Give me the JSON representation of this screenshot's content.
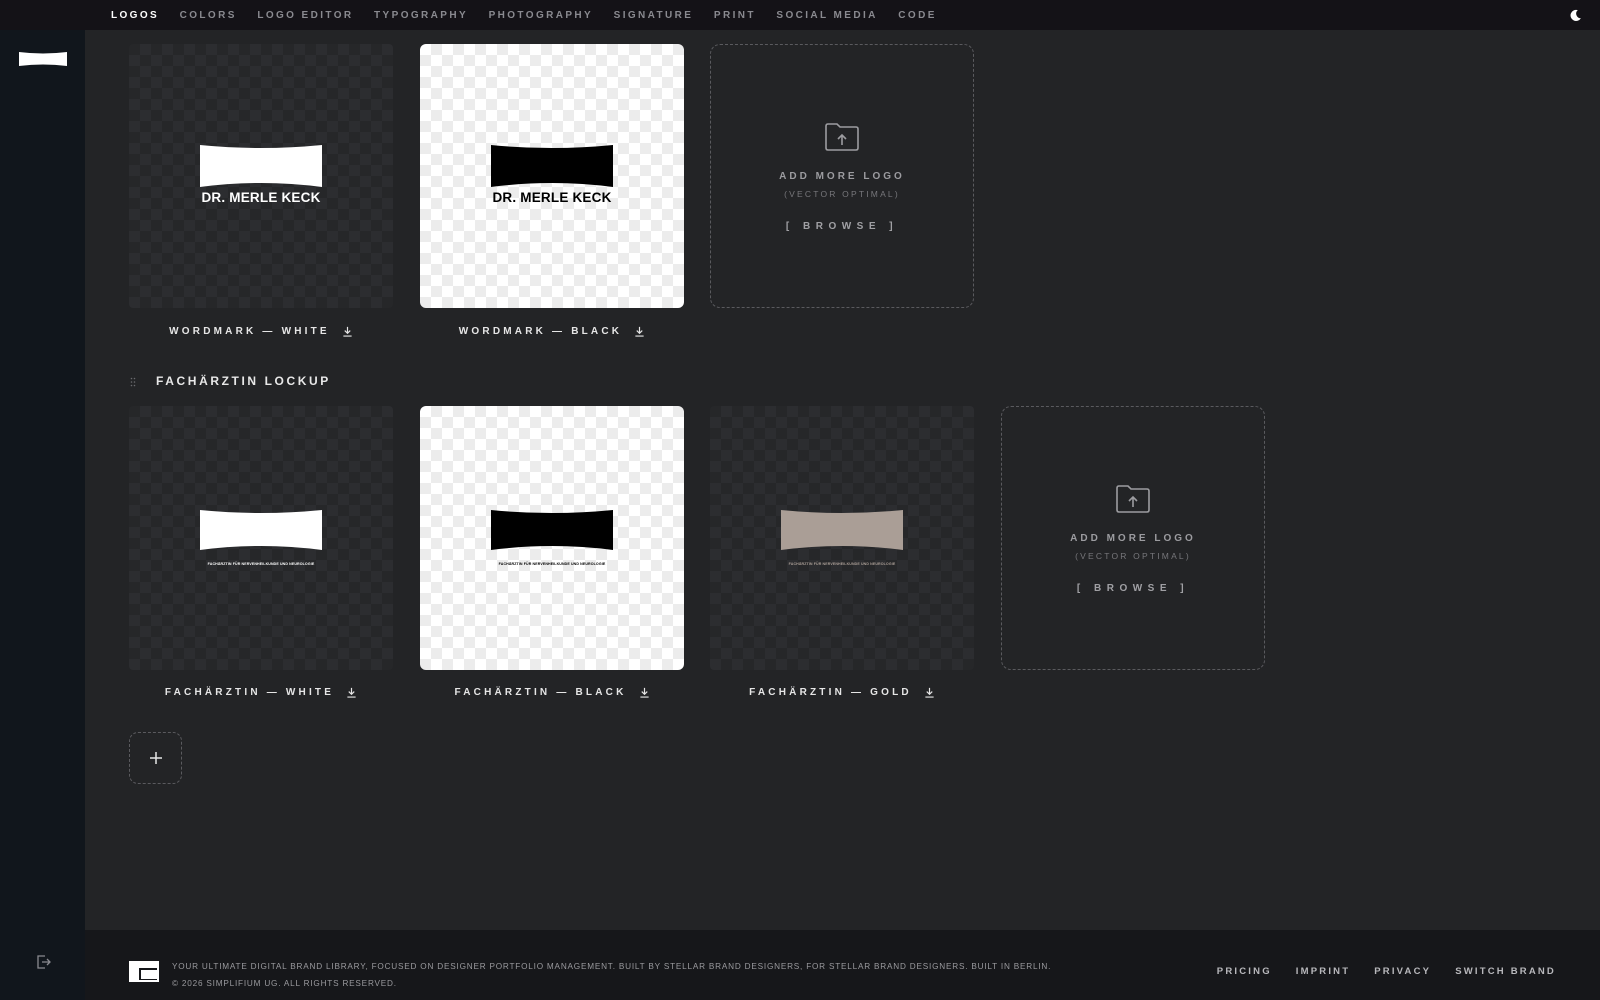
{
  "nav": {
    "tabs": [
      {
        "label": "LOGOS",
        "active": true
      },
      {
        "label": "COLORS"
      },
      {
        "label": "LOGO EDITOR"
      },
      {
        "label": "TYPOGRAPHY"
      },
      {
        "label": "PHOTOGRAPHY"
      },
      {
        "label": "SIGNATURE"
      },
      {
        "label": "PRINT"
      },
      {
        "label": "SOCIAL MEDIA"
      },
      {
        "label": "CODE"
      }
    ],
    "theme_icon": "moon-icon"
  },
  "sidebar": {
    "logo_icon": "brand-mark-icon",
    "logout_icon": "logout-icon"
  },
  "logo_text": {
    "wordmark": "DR. MERLE KECK",
    "tagline": "FACHÄRZTIN FÜR NERVENHEILKUNDE UND NEUROLOGIE"
  },
  "groups": [
    {
      "title": "",
      "items": [
        {
          "caption": "WORDMARK — WHITE",
          "variant": "white",
          "color": "#ffffff"
        },
        {
          "caption": "WORDMARK — BLACK",
          "variant": "black",
          "color": "#000000"
        }
      ]
    },
    {
      "title": "FACHÄRZTIN LOCKUP",
      "items": [
        {
          "caption": "FACHÄRZTIN — WHITE",
          "variant": "white",
          "color": "#ffffff"
        },
        {
          "caption": "FACHÄRZTIN — BLACK",
          "variant": "black",
          "color": "#000000"
        },
        {
          "caption": "FACHÄRZTIN — GOLD",
          "variant": "gold",
          "color": "#aa9e96"
        }
      ]
    }
  ],
  "upload": {
    "title": "ADD MORE LOGO",
    "subtitle": "(VECTOR OPTIMAL)",
    "browse": "[ BROWSE ]",
    "icon": "folder-upload-icon"
  },
  "add_group": {
    "icon": "plus-icon"
  },
  "footer": {
    "description": "YOUR ULTIMATE DIGITAL BRAND LIBRARY, FOCUSED ON DESIGNER PORTFOLIO MANAGEMENT. BUILT BY STELLAR BRAND DESIGNERS, FOR STELLAR BRAND DESIGNERS. BUILT IN BERLIN.",
    "copyright": "© 2026 SIMPLIFIUM UG. ALL RIGHTS RESERVED.",
    "links": [
      "PRICING",
      "IMPRINT",
      "PRIVACY",
      "SWITCH BRAND"
    ]
  }
}
